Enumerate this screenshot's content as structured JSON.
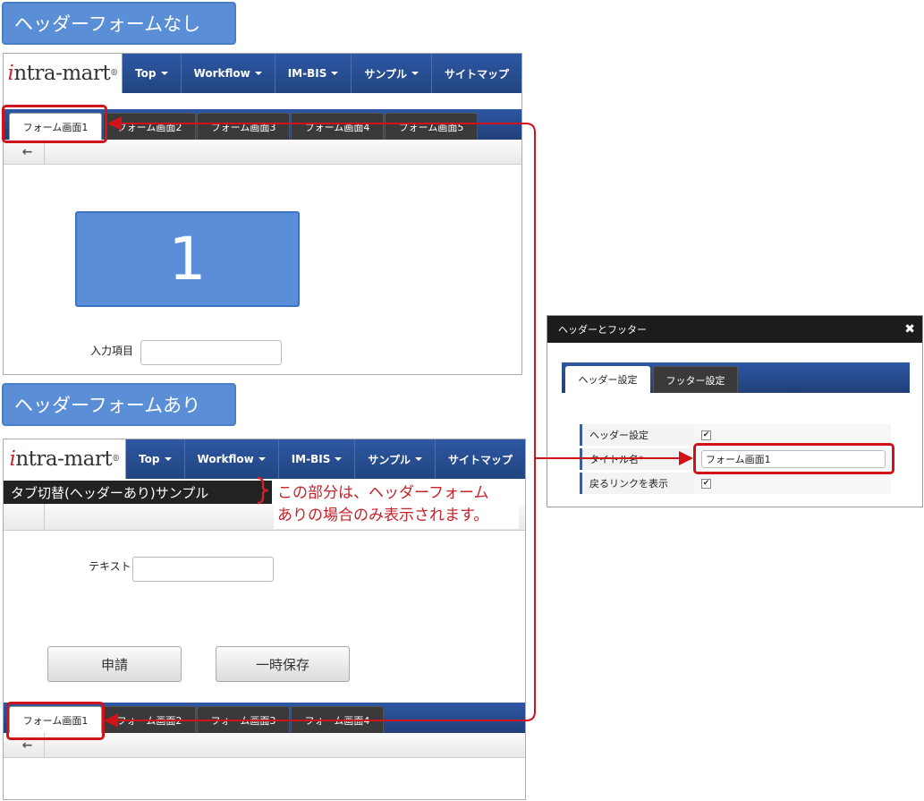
{
  "labels": {
    "no_header_form": "ヘッダーフォームなし",
    "with_header_form": "ヘッダーフォームあり"
  },
  "navbar": {
    "logo_i": "i",
    "logo_rest": "ntra-mart",
    "logo_reg": "®",
    "items": [
      "Top",
      "Workflow",
      "IM-BIS",
      "サンプル",
      "サイトマップ"
    ]
  },
  "top_panel": {
    "tabs": [
      "フォーム画面1",
      "フォーム画面2",
      "フォーム画面3",
      "フォーム画面4",
      "フォーム画面5"
    ],
    "back_icon": "←",
    "big_number": "1",
    "input_label": "入力項目",
    "input_value": ""
  },
  "bottom_panel": {
    "header_form_title": "タブ切替(ヘッダーあり)サンプル",
    "callout_line1": "この部分は、ヘッダーフォーム",
    "callout_line2": "ありの場合のみ表示されます。",
    "text_label": "テキスト",
    "text_value": "",
    "apply_button": "申請",
    "temp_save_button": "一時保存",
    "tabs": [
      "フォーム画面1",
      "フォーム画面2",
      "フォーム画面3",
      "フォーム画面4"
    ],
    "back_icon": "←"
  },
  "dialog": {
    "title": "ヘッダーとフッター",
    "close_icon": "✖",
    "tabs": [
      "ヘッダー設定",
      "フッター設定"
    ],
    "rows": [
      {
        "label": "ヘッダー設定",
        "checked": true
      },
      {
        "label": "タイトル名",
        "required": "*",
        "value": "フォーム画面1"
      },
      {
        "label": "戻るリンクを表示",
        "checked": true
      }
    ],
    "check_mark": "✔"
  },
  "colors": {
    "accent_blue": "#2e57a4",
    "highlight_red": "#d0121b",
    "label_blue": "#5a8ed6"
  }
}
